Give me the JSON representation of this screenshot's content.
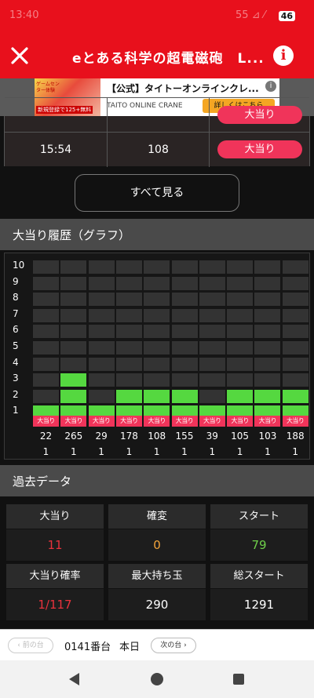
{
  "status_bar": {
    "time": "13:40",
    "middle": "55 ⊿ ⁄",
    "battery": "46"
  },
  "header": {
    "title": "eとある科学の超電磁砲　L..."
  },
  "ad": {
    "headline": "【公式】タイトーオンラインクレ...",
    "brand": "TAITO ONLINE CRANE",
    "cta": "詳しくはこちら",
    "thumb_text_top": "ゲームセンター体験",
    "thumb_text_bottom": "新規登録で125+無料",
    "info_glyph": "i"
  },
  "hit_history": {
    "rows": [
      {
        "time": "",
        "games": "",
        "result": "大当り"
      },
      {
        "time": "15:54",
        "games": "108",
        "result": "大当り"
      }
    ],
    "show_all_label": "すべて見る"
  },
  "graph": {
    "section_title": "大当り履歴（グラフ）",
    "y_labels": [
      "10",
      "9",
      "8",
      "7",
      "6",
      "5",
      "4",
      "3",
      "2",
      "1"
    ],
    "tag_label": "大当り",
    "columns": [
      {
        "level": 1,
        "games": "22",
        "count": "1"
      },
      {
        "level": 3,
        "games": "265",
        "count": "1"
      },
      {
        "level": 1,
        "games": "29",
        "count": "1"
      },
      {
        "level": 2,
        "games": "178",
        "count": "1"
      },
      {
        "level": 2,
        "games": "108",
        "count": "1"
      },
      {
        "level": 2,
        "games": "155",
        "count": "1"
      },
      {
        "level": 1,
        "games": "39",
        "count": "1"
      },
      {
        "level": 2,
        "games": "105",
        "count": "1"
      },
      {
        "level": 2,
        "games": "103",
        "count": "1"
      },
      {
        "level": 2,
        "games": "188",
        "count": "1"
      }
    ]
  },
  "past_data": {
    "section_title": "過去データ",
    "stats": [
      {
        "label": "大当り",
        "value": "11",
        "color": "#e8323c"
      },
      {
        "label": "確変",
        "value": "0",
        "color": "#f2a33a"
      },
      {
        "label": "スタート",
        "value": "79",
        "color": "#6fd04a"
      },
      {
        "label": "大当り確率",
        "value": "1/117",
        "color": "#e8323c"
      },
      {
        "label": "最大持ち玉",
        "value": "290",
        "color": "#ffffff"
      },
      {
        "label": "総スタート",
        "value": "1291",
        "color": "#ffffff"
      }
    ]
  },
  "bottom_nav": {
    "prev_label": "‹ 前の台",
    "machine_number": "0141番台",
    "day": "本日",
    "next_label": "次の台 ›"
  },
  "colors": {
    "brand_red": "#e8101c",
    "hit_pink": "#f0345a",
    "graph_green": "#55d840"
  }
}
